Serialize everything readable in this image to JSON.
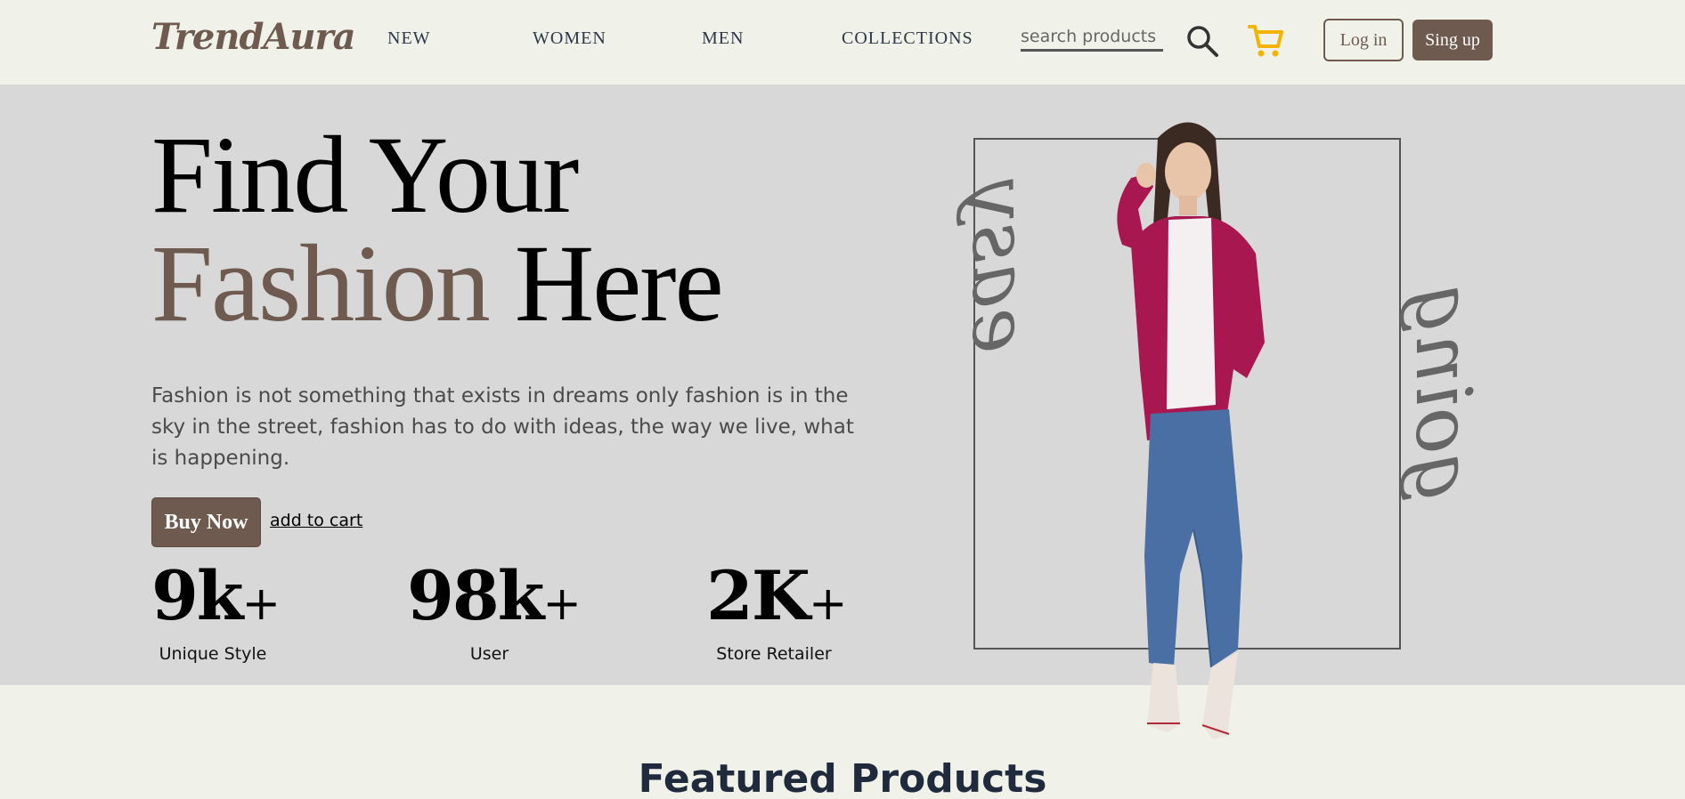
{
  "header": {
    "logo": "TrendAura",
    "nav": [
      "NEW",
      "WOMEN",
      "MEN",
      "COLLECTIONS"
    ],
    "search_placeholder": "search products",
    "login_label": "Log in",
    "signup_label": "Sing up",
    "icons": {
      "search": "search-icon",
      "cart": "cart-icon"
    },
    "cart_color": "#f5b301"
  },
  "hero": {
    "title_line1": "Find Your",
    "title_accent": "Fashion",
    "title_rest": "Here",
    "description": "Fashion is not something that exists in dreams only fashion is in the sky in the street, fashion has to do with ideas, the way we live, what is happening.",
    "buy_label": "Buy Now",
    "cart_link": "add to cart",
    "stats": [
      {
        "value": "9k",
        "plus": "+",
        "label": "Unique Style"
      },
      {
        "value": "98k",
        "plus": "+",
        "label": "User"
      },
      {
        "value": "2K",
        "plus": "+",
        "label": "Store Retailer"
      }
    ],
    "side_words": [
      "easy",
      "going"
    ]
  },
  "featured": {
    "title": "Featured Products"
  },
  "colors": {
    "brand": "#6e5a4f",
    "hero_bg": "#d8d8d8",
    "page_bg": "#f0f2ea"
  }
}
